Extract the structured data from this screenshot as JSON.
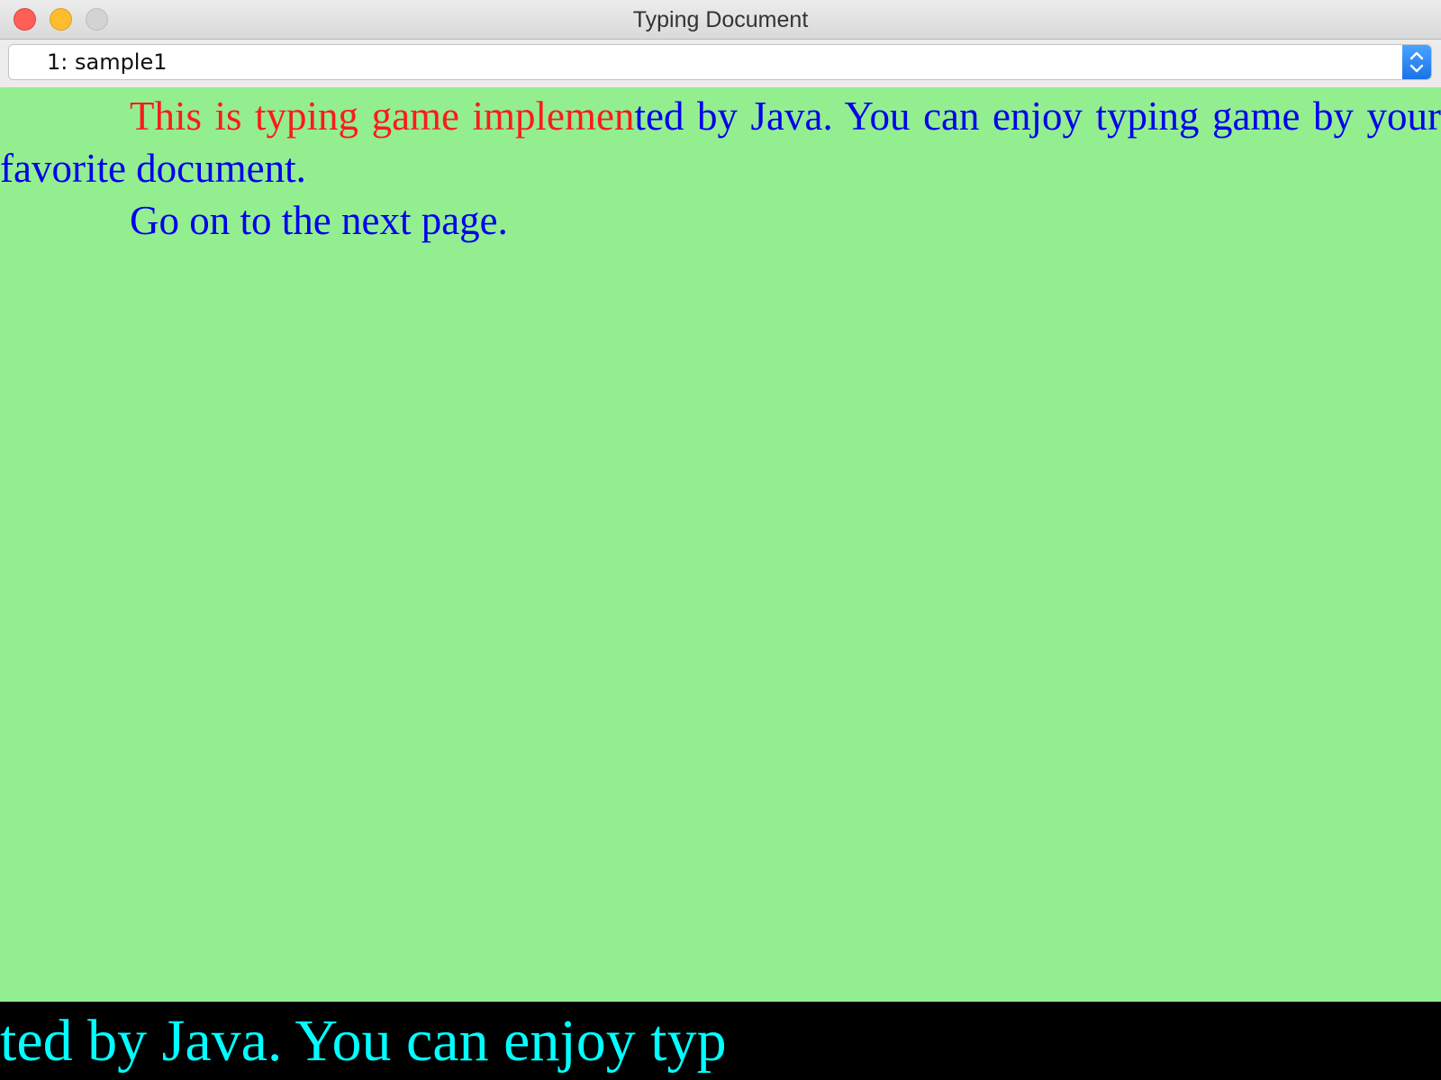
{
  "window": {
    "title": "Typing Document"
  },
  "document_selector": {
    "selected": "1: sample1"
  },
  "document": {
    "paragraphs": [
      {
        "typed": "This is typing game implemen",
        "remaining": "ted by Java. You can enjoy typing game by your favorite document."
      },
      {
        "typed": "",
        "remaining": "Go on to the next page."
      }
    ]
  },
  "input_bar": {
    "text": "ted by Java. You can enjoy typ"
  },
  "colors": {
    "document_background": "#93ee90",
    "typed_text": "#ff1a1a",
    "remaining_text": "#0000ee",
    "input_background": "#000000",
    "input_text": "#00ffff",
    "selector_accent": "#1a73e8"
  },
  "icons": {
    "close": "close-icon",
    "minimize": "minimize-icon",
    "zoom": "zoom-icon",
    "selector_arrows": "chevron-up-down-icon"
  }
}
